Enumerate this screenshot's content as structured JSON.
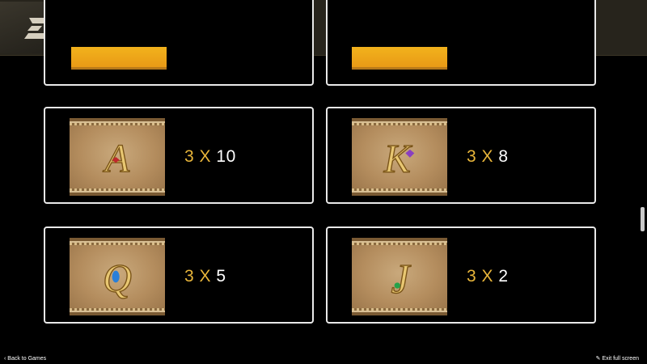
{
  "header": {
    "logo_icon": "dragon-logo-icon"
  },
  "symbols": [
    {
      "letter": "A",
      "gem": "#c0282c",
      "count": "3",
      "sep": "X",
      "value": "10"
    },
    {
      "letter": "K",
      "gem": "#8a3fc0",
      "count": "3",
      "sep": "X",
      "value": "8"
    },
    {
      "letter": "Q",
      "gem": "#2a7fd8",
      "count": "3",
      "sep": "X",
      "value": "5"
    },
    {
      "letter": "J",
      "gem": "#25a24a",
      "count": "3",
      "sep": "X",
      "value": "2"
    }
  ],
  "footer": {
    "back_icon": "chevron-left-icon",
    "back_label": "Back to Games",
    "exit_icon": "pencil-icon",
    "exit_label": "Exit full screen"
  },
  "colors": {
    "accent_gold": "#e8b53a",
    "card_border": "#e9e9e9",
    "header_bg": "#27241c"
  }
}
